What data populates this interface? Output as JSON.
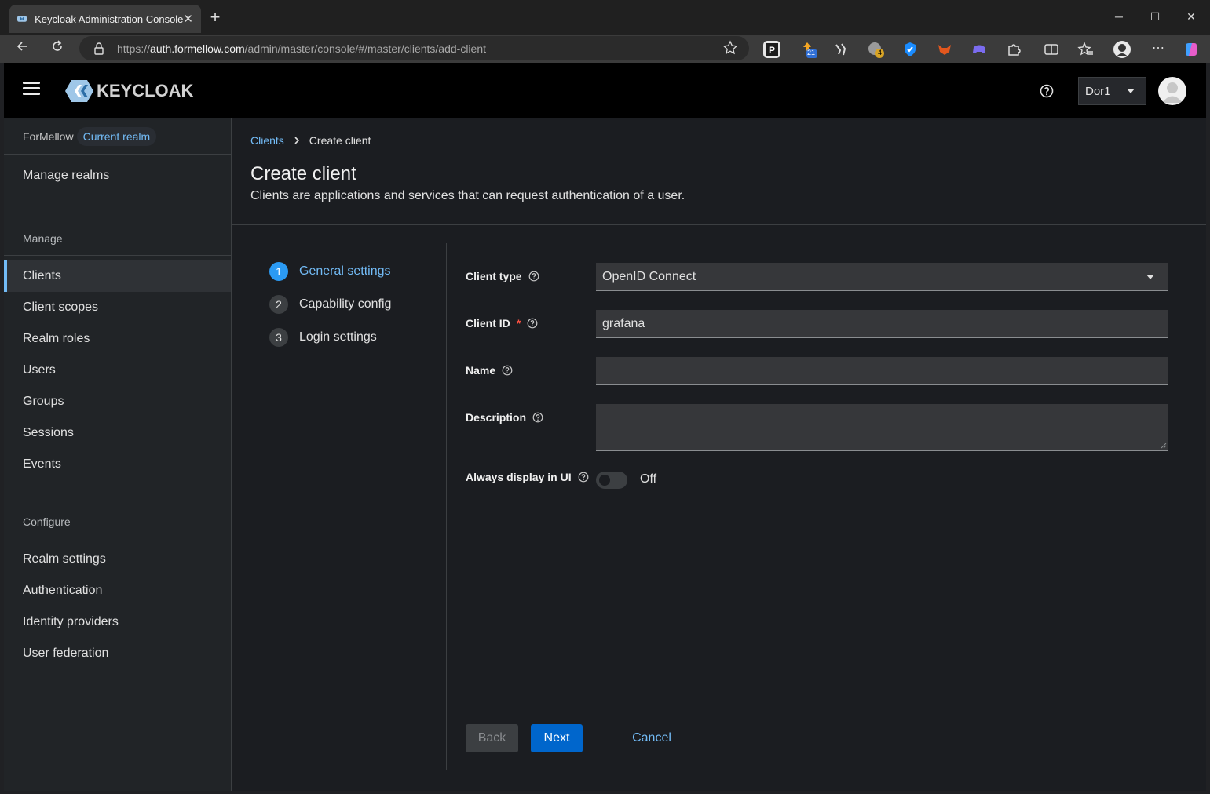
{
  "browser": {
    "tab_title": "Keycloak Administration Console",
    "tab_close": "✕",
    "new_tab": "+",
    "url_prefix": "https://",
    "url_host": "auth.formellow.com",
    "url_path": "/admin/master/console/#/master/clients/add-client",
    "window_minimize": "─",
    "window_maximize": "☐",
    "window_close": "✕"
  },
  "extensions": {
    "badge_21": "21",
    "badge_4": "4"
  },
  "masthead": {
    "logo_text": "KEYCLOAK",
    "user": "Dor1"
  },
  "sidebar": {
    "realm_name": "ForMellow",
    "realm_badge": "Current realm",
    "manage_realms": "Manage realms",
    "manage_section": "Manage",
    "manage_items": [
      "Clients",
      "Client scopes",
      "Realm roles",
      "Users",
      "Groups",
      "Sessions",
      "Events"
    ],
    "configure_section": "Configure",
    "configure_items": [
      "Realm settings",
      "Authentication",
      "Identity providers",
      "User federation"
    ]
  },
  "page": {
    "breadcrumb_parent": "Clients",
    "breadcrumb_current": "Create client",
    "title": "Create client",
    "description": "Clients are applications and services that can request authentication of a user."
  },
  "wizard": {
    "steps": [
      {
        "num": "1",
        "label": "General settings"
      },
      {
        "num": "2",
        "label": "Capability config"
      },
      {
        "num": "3",
        "label": "Login settings"
      }
    ]
  },
  "form": {
    "client_type_label": "Client type",
    "client_type_value": "OpenID Connect",
    "client_id_label": "Client ID",
    "client_id_required": "*",
    "client_id_value": "grafana",
    "name_label": "Name",
    "name_value": "",
    "description_label": "Description",
    "description_value": "",
    "always_display_label": "Always display in UI",
    "always_display_state": "Off"
  },
  "buttons": {
    "back": "Back",
    "next": "Next",
    "cancel": "Cancel"
  },
  "colors": {
    "accent": "#73bcf7",
    "primary_button": "#0066cc",
    "required": "#fe5142"
  }
}
